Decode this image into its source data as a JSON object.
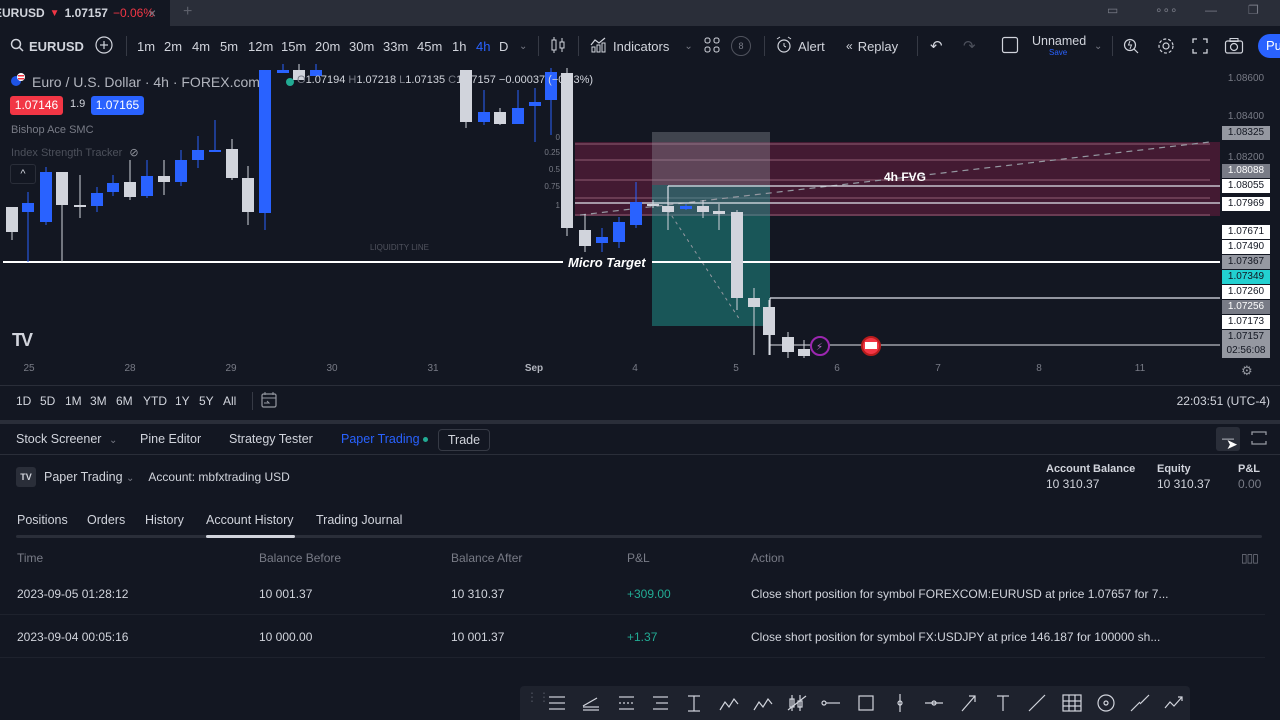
{
  "browser_tab": {
    "symbol": "EURUSD",
    "direction_icon": "triangle-down-icon",
    "price": "1.07157",
    "change_pct": "−0.06%",
    "close_label": "×",
    "new_tab_label": "+"
  },
  "toolbar": {
    "symbol": "EURUSD",
    "intervals": [
      "1m",
      "2m",
      "4m",
      "5m",
      "12m",
      "15m",
      "20m",
      "30m",
      "33m",
      "45m",
      "1h",
      "4h",
      "D"
    ],
    "active_interval": "4h",
    "indicators_label": "Indicators",
    "templates_badge": "8",
    "alert_label": "Alert",
    "replay_label": "Replay",
    "layout_name": "Unnamed",
    "save_label": "Save",
    "publish_label": "Pu"
  },
  "chart": {
    "title": "Euro / U.S. Dollar · 4h · FOREX.com",
    "ohlc": {
      "o_label": "O",
      "o": "1.07194",
      "h_label": "H",
      "h": "1.07218",
      "l_label": "L",
      "l": "1.07135",
      "c_label": "C",
      "c": "1.07157",
      "change": "−0.00037",
      "change_pct": "(−0.03%)"
    },
    "bid": "1.07146",
    "spread": "1.9",
    "ask": "1.07165",
    "indicators": [
      "Bishop Ace SMC",
      "Index Strength Tracker"
    ],
    "annotations": {
      "liquidity_line": "LIQUIDITY LINE",
      "micro_target": "Micro Target",
      "fvg": "4h FVG",
      "fib_levels": [
        "0",
        "0.25",
        "0.5",
        "0.75",
        "1"
      ]
    },
    "price_axis": [
      {
        "value": "1.08600",
        "style": "plain"
      },
      {
        "value": "1.08400",
        "style": "plain"
      },
      {
        "value": "1.08325",
        "style": "grey"
      },
      {
        "value": "1.08200",
        "style": "plain"
      },
      {
        "value": "1.08088",
        "style": "dgrey"
      },
      {
        "value": "1.08055",
        "style": "white"
      },
      {
        "value": "1.07969",
        "style": "white"
      },
      {
        "value": "1.07671",
        "style": "white"
      },
      {
        "value": "1.07490",
        "style": "white"
      },
      {
        "value": "1.07367",
        "style": "grey"
      },
      {
        "value": "1.07349",
        "style": "cyan"
      },
      {
        "value": "1.07260",
        "style": "white"
      },
      {
        "value": "1.07256",
        "style": "dgrey"
      },
      {
        "value": "1.07173",
        "style": "white"
      },
      {
        "value": "1.07157",
        "style": "grey"
      }
    ],
    "countdown": "02:56:08",
    "time_axis": [
      "25",
      "28",
      "29",
      "30",
      "31",
      "Sep",
      "4",
      "5",
      "6",
      "7",
      "8",
      "11"
    ]
  },
  "range_bar": {
    "ranges": [
      "1D",
      "5D",
      "1M",
      "3M",
      "6M",
      "YTD",
      "1Y",
      "5Y",
      "All"
    ],
    "clock": "22:03:51 (UTC-4)"
  },
  "panel_tabs": {
    "items": [
      "Stock Screener",
      "Pine Editor",
      "Strategy Tester",
      "Paper Trading"
    ],
    "active": "Paper Trading",
    "trade_label": "Trade"
  },
  "paper_trading": {
    "broker_label": "Paper Trading",
    "account": "Account: mbfxtrading USD",
    "stats": [
      {
        "label": "Account Balance",
        "value": "10 310.37"
      },
      {
        "label": "Equity",
        "value": "10 310.37"
      },
      {
        "label": "P&L",
        "value": "0.00"
      }
    ],
    "subtabs": [
      "Positions",
      "Orders",
      "History",
      "Account History",
      "Trading Journal"
    ],
    "active_subtab": "Account History",
    "columns": [
      "Time",
      "Balance Before",
      "Balance After",
      "P&L",
      "Action"
    ],
    "rows": [
      {
        "time": "2023-09-05 01:28:12",
        "before": "10 001.37",
        "after": "10 310.37",
        "pnl": "+309.00",
        "action": "Close short position for symbol FOREXCOM:EURUSD at price 1.07657 for 7..."
      },
      {
        "time": "2023-09-04 00:05:16",
        "before": "10 000.00",
        "after": "10 001.37",
        "pnl": "+1.37",
        "action": "Close short position for symbol FX:USDJPY at price 146.187 for 100000 sh..."
      }
    ]
  },
  "drawing_tools": [
    "horizontal-lines-icon",
    "parallel-channel-icon",
    "fib-retracement-icon",
    "fib-extension-icon",
    "price-range-icon",
    "elliott-wave-icon",
    "abcd-pattern-icon",
    "long-position-icon",
    "horizontal-ray-icon",
    "rectangle-icon",
    "vertical-line-icon",
    "cross-line-icon",
    "arrow-icon",
    "text-icon",
    "trend-line-icon",
    "gann-box-icon",
    "circle-icon",
    "extended-line-icon",
    "path-icon"
  ]
}
